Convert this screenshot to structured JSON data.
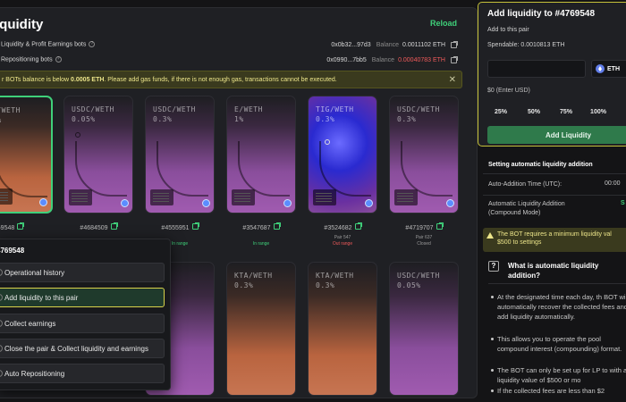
{
  "main": {
    "title": "iquidity",
    "reload": "Reload",
    "bot_rows": [
      {
        "label": "Liquidity & Profit Earnings bots",
        "address": "0x0b32...97d3",
        "balance_label": "Balance",
        "balance": "0.0011102 ETH"
      },
      {
        "label": "Repositioning bots",
        "address": "0x0990...7bb5",
        "balance_label": "Balance",
        "balance": "0.00040783 ETH"
      }
    ],
    "warning": {
      "prefix": "r BOTs balance is below ",
      "amount": "0.0005 ETH",
      "suffix": ". Please add gas funds, if there is not enough gas, transactions cannot be executed."
    }
  },
  "cards": [
    {
      "pair": "A/WETH",
      "fee": "3%",
      "id": "4769548",
      "status": ""
    },
    {
      "pair": "USDC/WETH",
      "fee": "0.05%",
      "id": "#4684509",
      "status": "In range"
    },
    {
      "pair": "USDC/WETH",
      "fee": "0.3%",
      "id": "#4555951",
      "status": "In range"
    },
    {
      "pair": "E/WETH",
      "fee": "1%",
      "id": "#3547687",
      "status": "In range"
    },
    {
      "pair": "TIG/WETH",
      "fee": "0.3%",
      "id": "#3524682",
      "status_top": "Pair 547",
      "status": "Out range"
    },
    {
      "pair": "USDC/WETH",
      "fee": "0.3%",
      "id": "#4719707",
      "status_top": "Pair 637",
      "status": "Closed"
    },
    {
      "pair": "",
      "fee": ""
    },
    {
      "pair": "KTA/WETH",
      "fee": "0.3%"
    },
    {
      "pair": "KTA/WETH",
      "fee": "0.3%"
    },
    {
      "pair": "KTA/WETH",
      "fee": "0.3%"
    },
    {
      "pair": "USDC/WETH",
      "fee": "0.05%"
    }
  ],
  "popup": {
    "title": "4769548",
    "items": [
      "Operational history",
      "Add liquidity to this pair",
      "Collect earnings",
      "Close the pair & Collect liquidity and earnings",
      "Auto Repositioning"
    ]
  },
  "side": {
    "title": "Add liquidity to #4769548",
    "sub": "Add to this pair",
    "spendable": "Spendable: 0.0010813 ETH",
    "token": "ETH",
    "usd": "$0 (Enter USD)",
    "pcts": [
      "25%",
      "50%",
      "75%",
      "100%"
    ],
    "add_btn": "Add Liquidity",
    "settings_title": "Setting automatic liquidity addition",
    "auto_time_label": "Auto-Addition Time (UTC):",
    "auto_time_value": "00:00",
    "compound_label_1": "Automatic Liquidity Addition",
    "compound_label_2": "(Compound Mode)",
    "compound_value": "S",
    "bot_warning_1": "The BOT requires a minimum liquidity val",
    "bot_warning_2": "$500 to settings",
    "faq_title_1": "What is automatic liquidity",
    "faq_title_2": "addition?",
    "bullets": [
      "At the designated time each day, th BOT will automatically recover the collected fees and add liquidity automatically.",
      "This allows you to operate the pool compound interest (compounding) format.",
      "The BOT can only be set up for LP to with a liquidity value of $500 or mo",
      "If the collected fees are less than $2"
    ]
  }
}
